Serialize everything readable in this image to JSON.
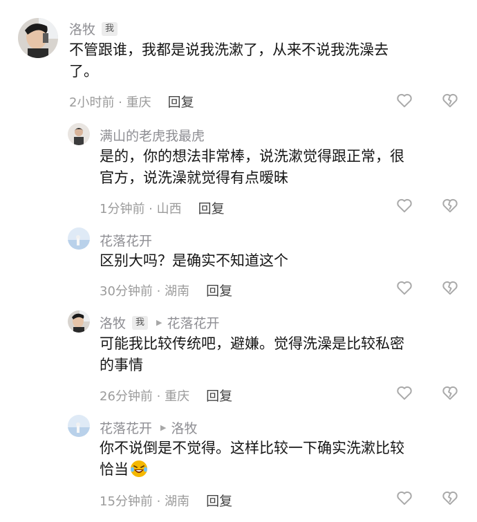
{
  "comments": [
    {
      "author": "洛牧",
      "badge": "我",
      "lines": [
        "不管跟谁，我都是说我洗漱了，从来不说我洗澡去",
        "了。"
      ],
      "time": "2小时前 · 重庆",
      "reply_label": "回复"
    },
    {
      "author": "满山的老虎我最虎",
      "lines": [
        "是的，你的想法非常棒，说洗漱觉得跟正常，很",
        "官方，说洗澡就觉得有点暧昧"
      ],
      "time": "1分钟前 · 山西",
      "reply_label": "回复"
    },
    {
      "author": "花落花开",
      "lines": [
        "区别大吗？是确实不知道这个"
      ],
      "time": "30分钟前 · 湖南",
      "reply_label": "回复"
    },
    {
      "author": "洛牧",
      "badge": "我",
      "reply_to": "花落花开",
      "lines": [
        "可能我比较传统吧，避嫌。觉得洗澡是比较私密",
        "的事情"
      ],
      "time": "26分钟前 · 重庆",
      "reply_label": "回复"
    },
    {
      "author": "花落花开",
      "reply_to": "洛牧",
      "lines": [
        "你不说倒是不觉得。这样比较一下确实洗漱比较",
        "恰当"
      ],
      "emoji": "laughing-crying-emoji",
      "time": "15分钟前 · 湖南",
      "reply_label": "回复"
    }
  ],
  "icons": {
    "like": "heart-outline-icon",
    "dislike": "broken-heart-outline-icon"
  }
}
